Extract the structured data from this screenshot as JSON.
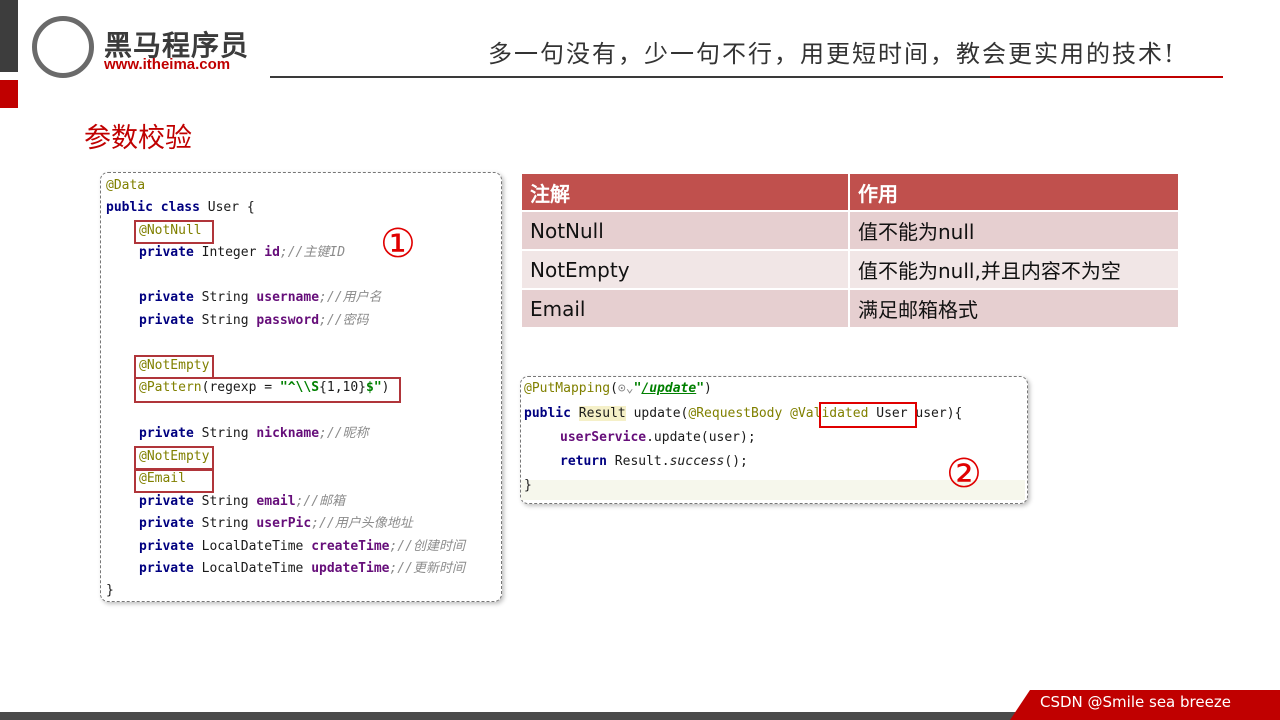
{
  "header": {
    "logo_title": "黑马程序员",
    "logo_url": "www.itheima.com",
    "slogan": "多一句没有，少一句不行，用更短时间，教会更实用的技术!"
  },
  "page_title": "参数校验",
  "code_user": {
    "line1": "@Data",
    "line2_kw": "public class",
    "line2_rest": " User {",
    "notnull": "@NotNull",
    "id_kw": "private",
    "id_type": " Integer ",
    "id_name": "id",
    "id_cmt": ";//主键ID",
    "username_kw": "private",
    "username_type": " String ",
    "username_name": "username",
    "username_cmt": ";//用户名",
    "password_kw": "private",
    "password_type": " String ",
    "password_name": "password",
    "password_cmt": ";//密码",
    "notempty1": "@NotEmpty",
    "pattern_ann": "@Pattern",
    "pattern_mid": "(regexp = ",
    "pattern_str1": "\"^\\\\S",
    "pattern_quant": "{1,10}",
    "pattern_str2": "$\"",
    "pattern_end": ")",
    "nickname_kw": "private",
    "nickname_type": " String ",
    "nickname_name": "nickname",
    "nickname_cmt": ";//昵称",
    "notempty2": "@NotEmpty",
    "email_ann": "@Email",
    "email_kw": "private",
    "email_type": " String ",
    "email_name": "email",
    "email_cmt": ";//邮箱",
    "userpic_kw": "private",
    "userpic_type": " String ",
    "userpic_name": "userPic",
    "userpic_cmt": ";//用户头像地址",
    "createtime_kw": "private",
    "createtime_type": " LocalDateTime ",
    "createtime_name": "createTime",
    "createtime_cmt": ";//创建时间",
    "updatetime_kw": "private",
    "updatetime_type": " LocalDateTime ",
    "updatetime_name": "updateTime",
    "updatetime_cmt": ";//更新时间",
    "close": "}"
  },
  "marker1": "①",
  "marker2": "②",
  "table": {
    "headers": [
      "注解",
      "作用"
    ],
    "rows": [
      [
        "NotNull",
        "值不能为null"
      ],
      [
        "NotEmpty",
        "值不能为null,并且内容不为空"
      ],
      [
        "Email",
        "满足邮箱格式"
      ]
    ]
  },
  "code_update": {
    "mapping_ann": "@PutMapping",
    "mapping_open": "(",
    "mapping_icon": "⊙",
    "mapping_str_q1": "\"",
    "mapping_str": "/update",
    "mapping_str_q2": "\"",
    "mapping_close": ")",
    "sig_kw": "public",
    "sig_ret": "Result",
    "sig_method": " update(",
    "sig_reqbody": "@RequestBody",
    "sig_validated": "@Validated",
    "sig_rest": " User user){",
    "body1_obj": "userService",
    "body1_rest": ".update(user);",
    "body2_kw": "return",
    "body2_obj": " Result.",
    "body2_call": "success",
    "body2_end": "();",
    "close": "}"
  },
  "footer": {
    "text": "CSDN @Smile sea breeze"
  }
}
